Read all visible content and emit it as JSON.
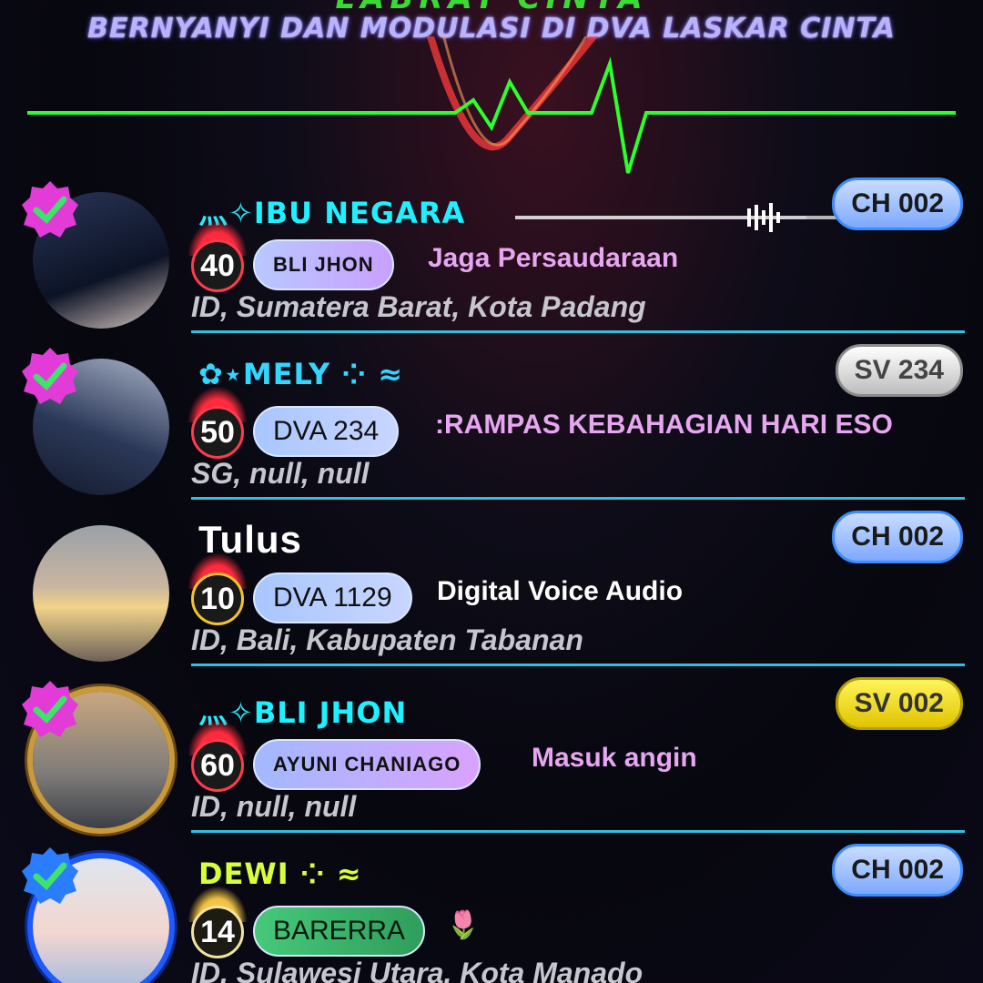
{
  "header": {
    "title_partial": "LABRAT CINTA",
    "subtitle": "BERNYANYI DAN MODULASI DI DVA LASKAR CINTA"
  },
  "colors": {
    "heartbeat": "#2cff2c",
    "divider": "#33bfe0",
    "verified": "#e23bd8"
  },
  "rows": [
    {
      "name": "⺣✧IBU NEGARA",
      "level": "40",
      "tag": "BLI JHON",
      "status": "Jaga Persaudaraan",
      "location": "ID, Sumatera Barat, Kota Padang",
      "channel": "CH 002",
      "verified": true
    },
    {
      "name": "✿⋆MELY ⁘ ≈",
      "level": "50",
      "tag": "DVA 234",
      "status": ":RAMPAS KEBAHAGIAN HARI ESO",
      "location": "SG, null, null",
      "channel": "SV 234",
      "verified": true
    },
    {
      "name": "Tulus",
      "level": "10",
      "tag": "DVA 1129",
      "status": "Digital Voice Audio",
      "location": "ID, Bali, Kabupaten Tabanan",
      "channel": "CH 002",
      "verified": false
    },
    {
      "name": "⺣✧BLI JHON",
      "level": "60",
      "tag": "AYUNI CHANIAGO",
      "status": "Masuk angin",
      "location": "ID, null, null",
      "channel": "SV 002",
      "verified": true
    },
    {
      "name": "DEWI ⁘ ≈",
      "level": "14",
      "tag": "BARERRA",
      "status": "🌷",
      "location": "ID, Sulawesi Utara, Kota Manado",
      "channel": "CH 002",
      "verified": true
    }
  ]
}
